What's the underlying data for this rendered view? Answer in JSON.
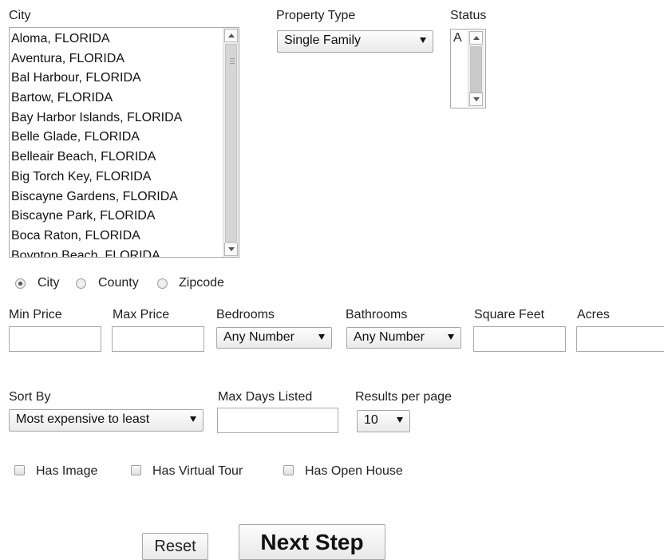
{
  "city": {
    "label": "City",
    "options": [
      "Aloma, FLORIDA",
      "Aventura, FLORIDA",
      "Bal Harbour, FLORIDA",
      "Bartow, FLORIDA",
      "Bay Harbor Islands, FLORIDA",
      "Belle Glade, FLORIDA",
      "Belleair Beach, FLORIDA",
      "Big Torch Key, FLORIDA",
      "Biscayne Gardens, FLORIDA",
      "Biscayne Park, FLORIDA",
      "Boca Raton, FLORIDA",
      "Boynton Beach, FLORIDA"
    ]
  },
  "property_type": {
    "label": "Property Type",
    "value": "Single Family"
  },
  "status": {
    "label": "Status",
    "value": "A"
  },
  "search_by": {
    "options": [
      "City",
      "County",
      "Zipcode"
    ],
    "selected": "City"
  },
  "filters": {
    "min_price": {
      "label": "Min Price",
      "value": ""
    },
    "max_price": {
      "label": "Max Price",
      "value": ""
    },
    "bedrooms": {
      "label": "Bedrooms",
      "value": "Any Number"
    },
    "bathrooms": {
      "label": "Bathrooms",
      "value": "Any Number"
    },
    "square_feet": {
      "label": "Square Feet",
      "value": ""
    },
    "acres": {
      "label": "Acres",
      "value": ""
    }
  },
  "sort_by": {
    "label": "Sort By",
    "value": "Most expensive to least"
  },
  "max_days_listed": {
    "label": "Max Days Listed",
    "value": ""
  },
  "results_per_page": {
    "label": "Results per page",
    "value": "10"
  },
  "checkboxes": {
    "has_image": "Has Image",
    "has_virtual_tour": "Has Virtual Tour",
    "has_open_house": "Has Open House"
  },
  "buttons": {
    "reset": "Reset",
    "next_step": "Next Step"
  }
}
